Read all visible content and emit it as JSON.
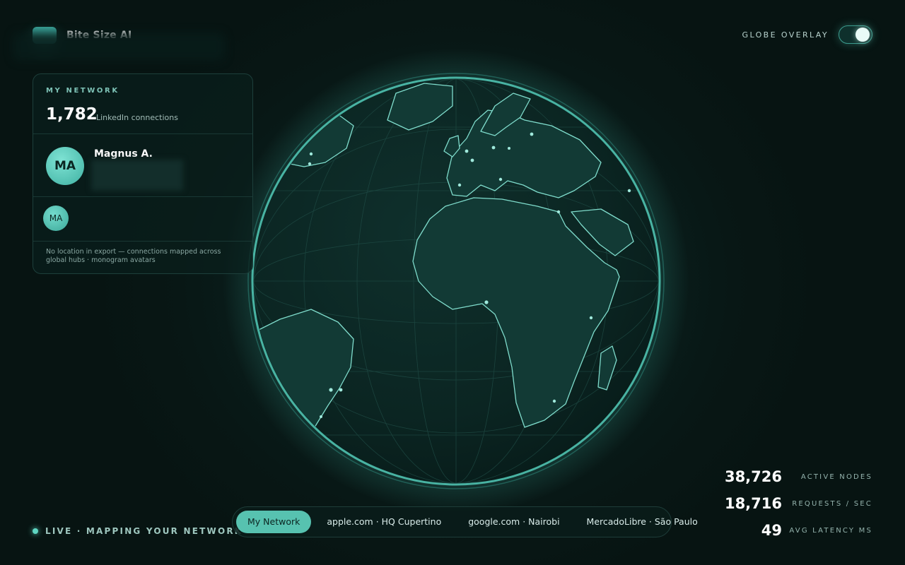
{
  "brand": {
    "name": "Bite Size AI"
  },
  "overlay": {
    "label": "GLOBE OVERLAY",
    "enabled": true
  },
  "network": {
    "eyebrow": "MY NETWORK",
    "count": "1,782",
    "count_label": "LinkedIn connections",
    "profile": {
      "initials": "MA",
      "name": "Magnus A."
    },
    "connection": {
      "initials": "MA"
    },
    "note": "No location in export — connections mapped across global hubs · monogram avatars"
  },
  "live": {
    "text": "LIVE · MAPPING YOUR NETWORK"
  },
  "tabs": [
    {
      "label": "My Network",
      "active": true
    },
    {
      "label": "apple.com · HQ Cupertino",
      "active": false
    },
    {
      "label": "google.com · Nairobi",
      "active": false
    },
    {
      "label": "MercadoLibre · São Paulo",
      "active": false
    }
  ],
  "stats": [
    {
      "value": "38,726",
      "label": "ACTIVE NODES"
    },
    {
      "value": "18,716",
      "label": "REQUESTS / SEC"
    },
    {
      "value": "49",
      "label": "AVG LATENCY MS"
    }
  ],
  "colors": {
    "accent": "#57c2b0",
    "background": "#081715",
    "globe": "#0b2623",
    "coast": "#8ee6d6"
  }
}
